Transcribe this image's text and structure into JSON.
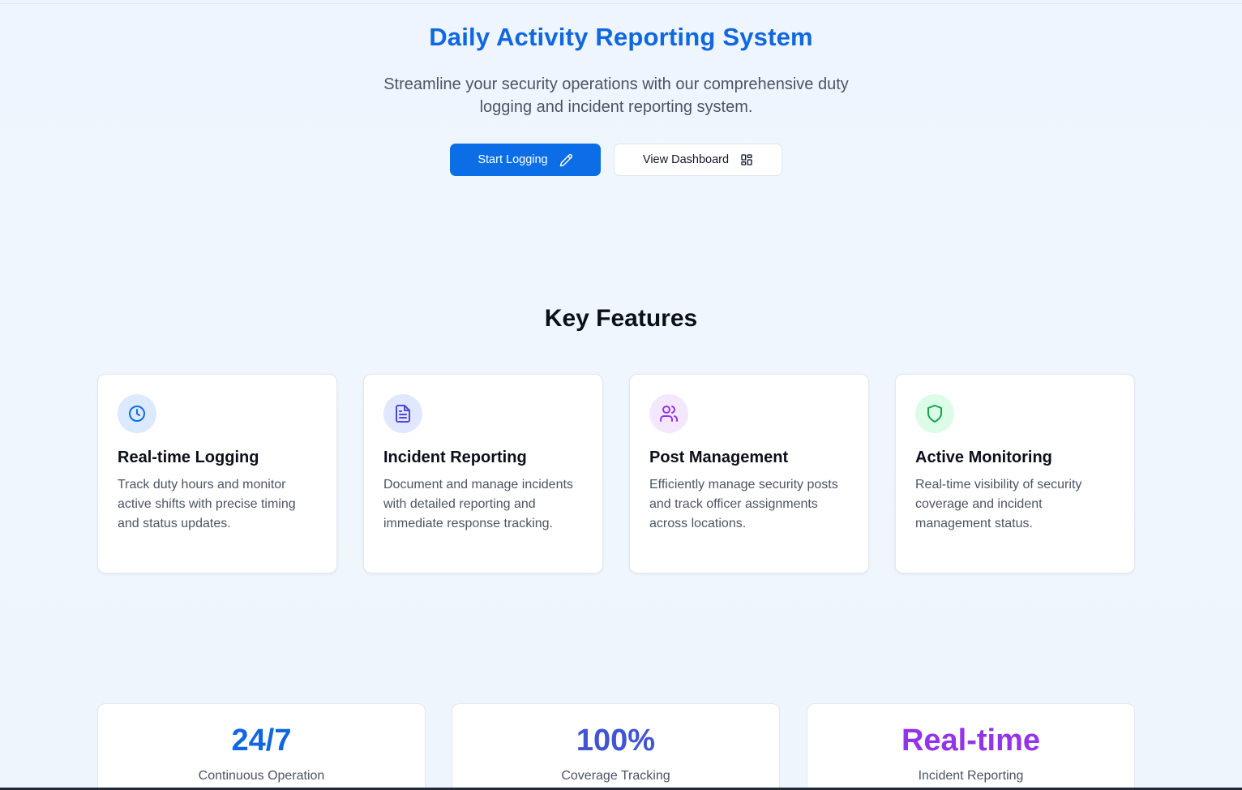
{
  "hero": {
    "title": "Daily Activity Reporting System",
    "subtitle": "Streamline your security operations with our comprehensive duty logging and incident reporting system.",
    "primary_button": "Start Logging",
    "secondary_button": "View Dashboard",
    "primary_icon": "pencil-icon",
    "secondary_icon": "dashboard-grid-icon"
  },
  "features": {
    "title": "Key Features",
    "items": [
      {
        "title": "Real-time Logging",
        "description": "Track duty hours and monitor active shifts with precise timing and status updates.",
        "icon": "clock-icon",
        "icon_color": "#0b6ee6",
        "icon_bg": "#dbeafe"
      },
      {
        "title": "Incident Reporting",
        "description": "Document and manage incidents with detailed reporting and immediate response tracking.",
        "icon": "document-icon",
        "icon_color": "#4f46e5",
        "icon_bg": "#e0e7ff"
      },
      {
        "title": "Post Management",
        "description": "Efficiently manage security posts and track officer assignments across locations.",
        "icon": "users-icon",
        "icon_color": "#9333ea",
        "icon_bg": "#f3e8ff"
      },
      {
        "title": "Active Monitoring",
        "description": "Real-time visibility of security coverage and incident management status.",
        "icon": "shield-icon",
        "icon_color": "#16a34a",
        "icon_bg": "#dcfce7"
      }
    ]
  },
  "stats": [
    {
      "value": "24/7",
      "label": "Continuous Operation",
      "color": "#1067e0"
    },
    {
      "value": "100%",
      "label": "Coverage Tracking",
      "color": "#4254d6"
    },
    {
      "value": "Real-time",
      "label": "Incident Reporting",
      "color": "#9333ea"
    }
  ],
  "colors": {
    "brand": "#1067e0",
    "primary_button": "#0b6ee6",
    "background": "#eef5fd"
  }
}
